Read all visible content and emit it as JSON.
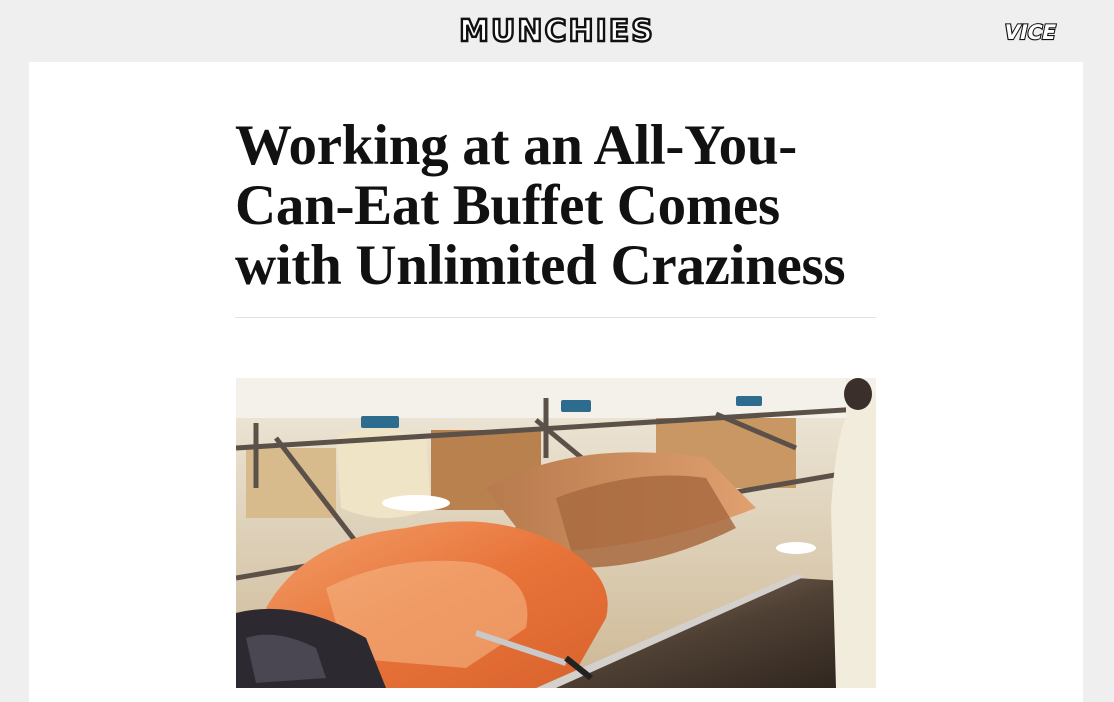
{
  "header": {
    "site_logo": "MUNCHIES",
    "network_logo": "VICE"
  },
  "article": {
    "headline": "Working at an All-You-Can-Eat Buffet Comes with Unlimited Craziness",
    "hero_image_alt": "Seafood buffet line with shrimp and crab legs"
  },
  "colors": {
    "page_background": "#efefef",
    "card_background": "#ffffff",
    "text": "#111111",
    "rule": "#e2e2e2"
  }
}
